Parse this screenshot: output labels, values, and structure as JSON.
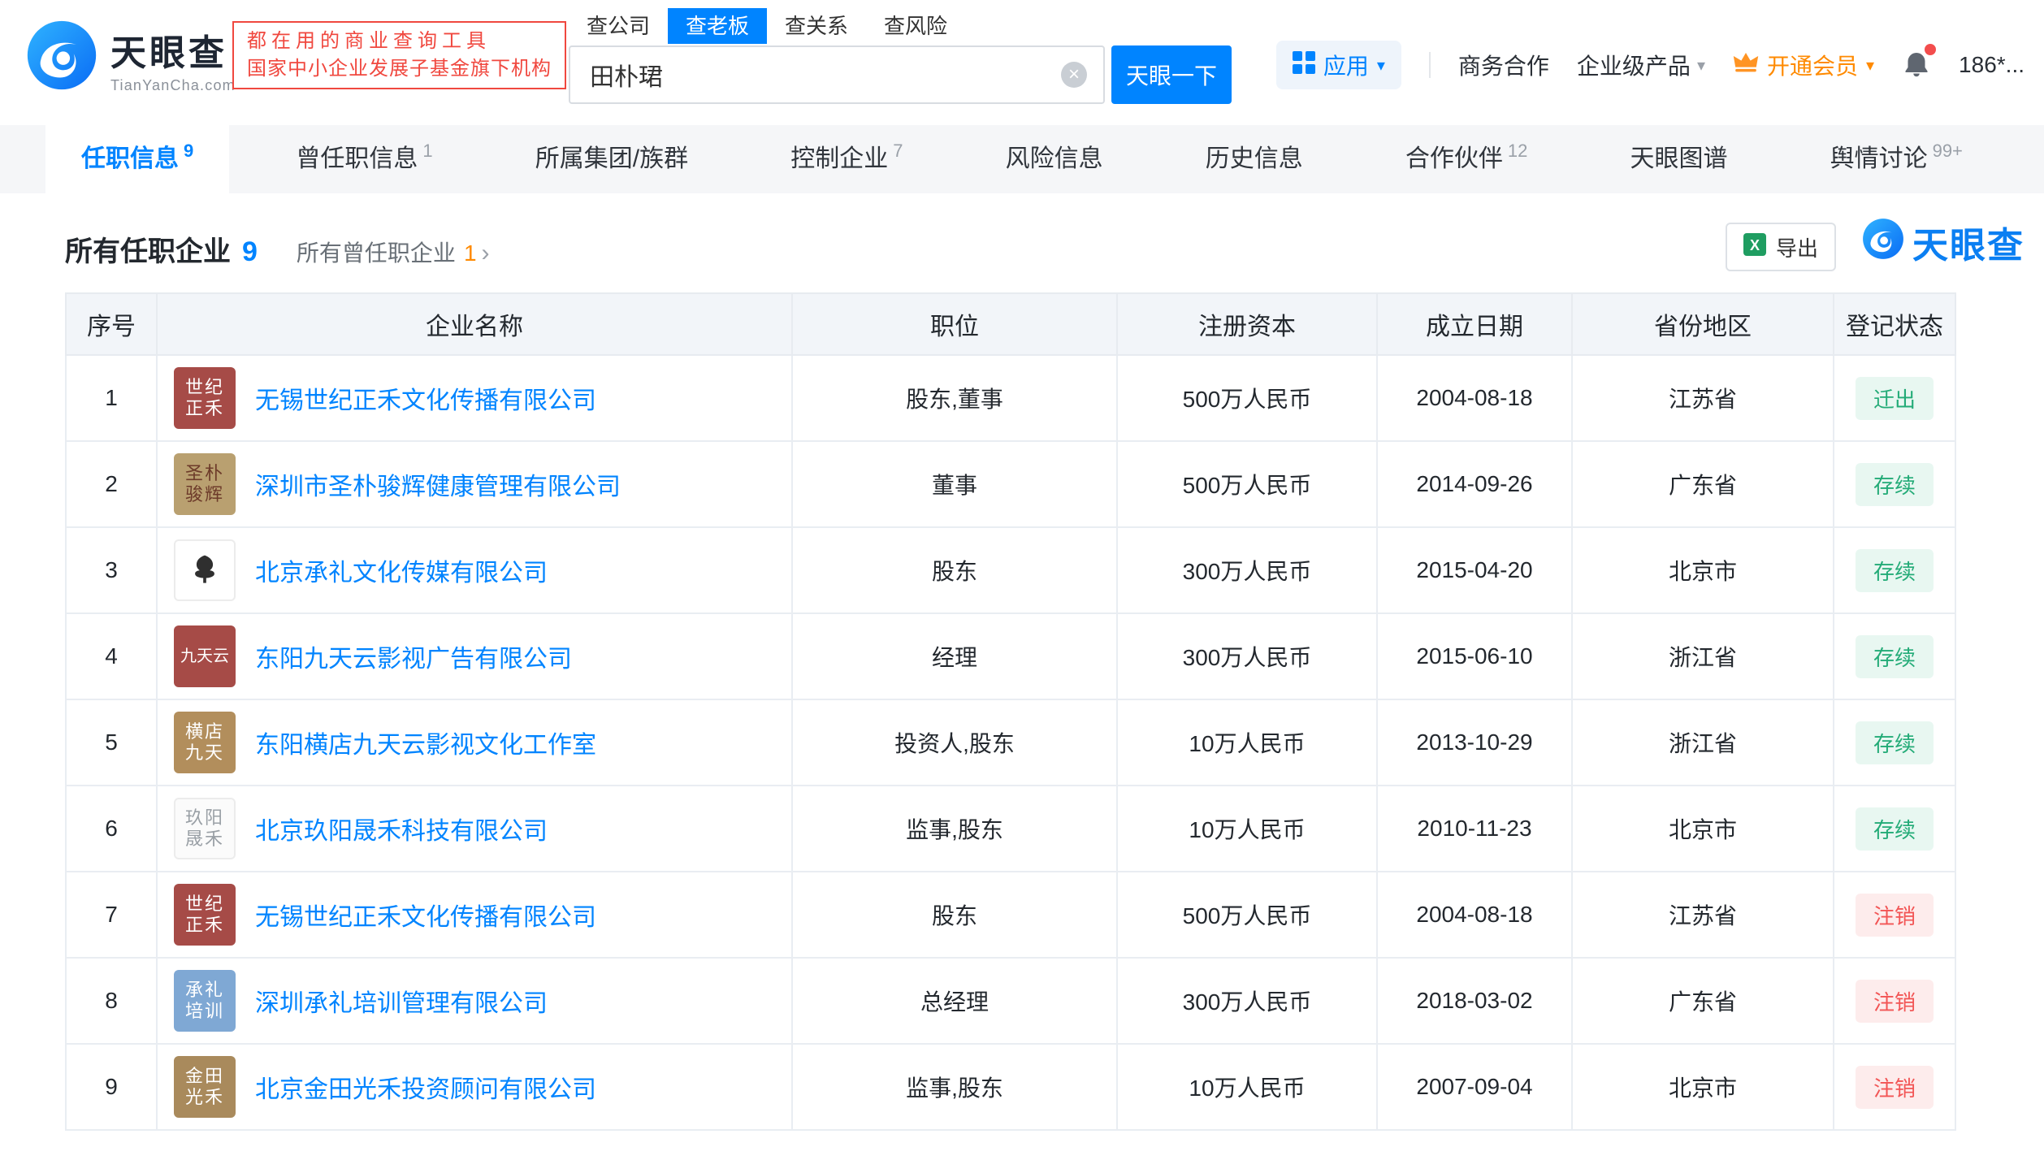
{
  "colors": {
    "accent_blue": "#0084ff",
    "vip_orange": "#ff8a00",
    "slogan_red": "#f0483f",
    "status_green": "#23ab77",
    "status_red": "#f25555"
  },
  "icons": {
    "caret_down": "▾",
    "clear": "×",
    "arrow_right": "›"
  },
  "header": {
    "brand": "天眼查",
    "brand_domain": "TianYanCha.com",
    "slogan_line1": "都在用的商业查询工具",
    "slogan_line2": "国家中小企业发展子基金旗下机构",
    "search_tabs": [
      {
        "label": "查公司",
        "active": false
      },
      {
        "label": "查老板",
        "active": true
      },
      {
        "label": "查关系",
        "active": false
      },
      {
        "label": "查风险",
        "active": false
      }
    ],
    "search_value": "田朴珺",
    "search_button": "天眼一下",
    "apps_label": "应用",
    "biz_label": "商务合作",
    "enterprise_label": "企业级产品",
    "vip_label": "开通会员",
    "phone": "186*..."
  },
  "nav_tabs": [
    {
      "label": "任职信息",
      "count": "9",
      "active": true
    },
    {
      "label": "曾任职信息",
      "count": "1",
      "active": false
    },
    {
      "label": "所属集团/族群",
      "count": "",
      "active": false
    },
    {
      "label": "控制企业",
      "count": "7",
      "active": false
    },
    {
      "label": "风险信息",
      "count": "",
      "active": false
    },
    {
      "label": "历史信息",
      "count": "",
      "active": false
    },
    {
      "label": "合作伙伴",
      "count": "12",
      "active": false
    },
    {
      "label": "天眼图谱",
      "count": "",
      "active": false
    },
    {
      "label": "舆情讨论",
      "count": "99+",
      "active": false
    }
  ],
  "section": {
    "title": "所有任职企业",
    "title_count": "9",
    "subtitle": "所有曾任职企业",
    "subtitle_count": "1",
    "export_label": "导出",
    "watermark_brand": "天眼查"
  },
  "table": {
    "headers": [
      "序号",
      "企业名称",
      "职位",
      "注册资本",
      "成立日期",
      "省份地区",
      "登记状态"
    ],
    "rows": [
      {
        "no": "1",
        "logo": {
          "lines": [
            "世纪",
            "正禾"
          ],
          "bg": "#a64b47",
          "fg": "#ffffff"
        },
        "company": "无锡世纪正禾文化传播有限公司",
        "position": "股东,董事",
        "capital": "500万人民币",
        "date": "2004-08-18",
        "province": "江苏省",
        "status": "迁出",
        "status_type": "green"
      },
      {
        "no": "2",
        "logo": {
          "lines": [
            "圣朴",
            "骏辉"
          ],
          "bg": "#b9a070",
          "fg": "#6d3b2a"
        },
        "company": "深圳市圣朴骏辉健康管理有限公司",
        "position": "董事",
        "capital": "500万人民币",
        "date": "2014-09-26",
        "province": "广东省",
        "status": "存续",
        "status_type": "green"
      },
      {
        "no": "3",
        "logo": {
          "icon": "tree",
          "bg": "#ffffff",
          "fg": "#2f2f2f",
          "border": true
        },
        "company": "北京承礼文化传媒有限公司",
        "position": "股东",
        "capital": "300万人民币",
        "date": "2015-04-20",
        "province": "北京市",
        "status": "存续",
        "status_type": "green"
      },
      {
        "no": "4",
        "logo": {
          "lines": [
            "九天云"
          ],
          "bg": "#a64b47",
          "fg": "#ffffff"
        },
        "company": "东阳九天云影视广告有限公司",
        "position": "经理",
        "capital": "300万人民币",
        "date": "2015-06-10",
        "province": "浙江省",
        "status": "存续",
        "status_type": "green"
      },
      {
        "no": "5",
        "logo": {
          "lines": [
            "横店",
            "九天"
          ],
          "bg": "#b28e5c",
          "fg": "#ffffff"
        },
        "company": "东阳横店九天云影视文化工作室",
        "position": "投资人,股东",
        "capital": "10万人民币",
        "date": "2013-10-29",
        "province": "浙江省",
        "status": "存续",
        "status_type": "green"
      },
      {
        "no": "6",
        "logo": {
          "lines": [
            "玖阳",
            "晟禾"
          ],
          "bg": "#fbfbfb",
          "fg": "#9aa0a6",
          "border": true
        },
        "company": "北京玖阳晟禾科技有限公司",
        "position": "监事,股东",
        "capital": "10万人民币",
        "date": "2010-11-23",
        "province": "北京市",
        "status": "存续",
        "status_type": "green"
      },
      {
        "no": "7",
        "logo": {
          "lines": [
            "世纪",
            "正禾"
          ],
          "bg": "#a64b47",
          "fg": "#ffffff"
        },
        "company": "无锡世纪正禾文化传播有限公司",
        "position": "股东",
        "capital": "500万人民币",
        "date": "2004-08-18",
        "province": "江苏省",
        "status": "注销",
        "status_type": "red"
      },
      {
        "no": "8",
        "logo": {
          "lines": [
            "承礼",
            "培训"
          ],
          "bg": "#7fa8d4",
          "fg": "#ffffff"
        },
        "company": "深圳承礼培训管理有限公司",
        "position": "总经理",
        "capital": "300万人民币",
        "date": "2018-03-02",
        "province": "广东省",
        "status": "注销",
        "status_type": "red"
      },
      {
        "no": "9",
        "logo": {
          "lines": [
            "金田",
            "光禾"
          ],
          "bg": "#a98a5c",
          "fg": "#ffffff"
        },
        "company": "北京金田光禾投资顾问有限公司",
        "position": "监事,股东",
        "capital": "10万人民币",
        "date": "2007-09-04",
        "province": "北京市",
        "status": "注销",
        "status_type": "red"
      }
    ]
  }
}
